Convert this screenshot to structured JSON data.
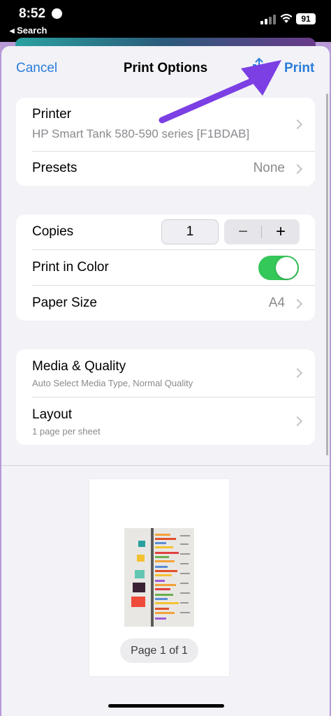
{
  "status_bar": {
    "time": "8:52",
    "back_label": "◂ Search",
    "battery": "91"
  },
  "nav": {
    "cancel": "Cancel",
    "title": "Print Options",
    "print": "Print",
    "share_icon": "share-icon"
  },
  "printer_card": {
    "printer_label": "Printer",
    "printer_name": "HP Smart Tank 580-590 series [F1BDAB]",
    "presets_label": "Presets",
    "presets_value": "None"
  },
  "options_card": {
    "copies_label": "Copies",
    "copies_value": "1",
    "minus": "−",
    "plus": "+",
    "color_label": "Print in Color",
    "color_on": true,
    "paper_label": "Paper Size",
    "paper_value": "A4"
  },
  "quality_card": {
    "media_label": "Media & Quality",
    "media_sub": "Auto Select Media Type, Normal Quality",
    "layout_label": "Layout",
    "layout_sub": "1 page per sheet"
  },
  "preview": {
    "page_label": "Page 1 of 1"
  },
  "colors": {
    "accent": "#2a7cd9",
    "toggle_on": "#34c759",
    "annotation_arrow": "#7b3fe4"
  }
}
